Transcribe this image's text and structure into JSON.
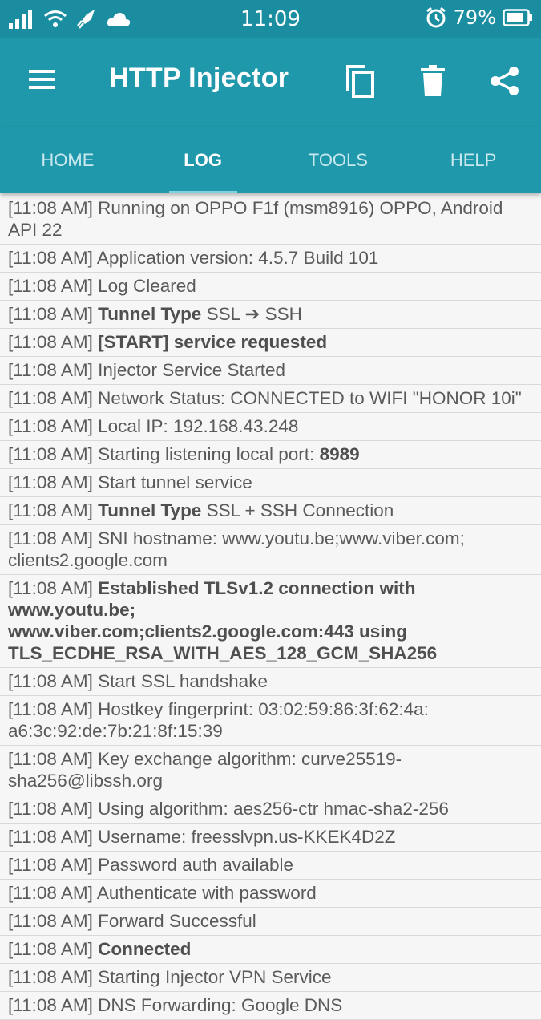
{
  "status_bar": {
    "time": "11:09",
    "battery": "79%",
    "icons": [
      "signal-icon",
      "wifi-icon",
      "rocket-icon",
      "cloud-icon",
      "alarm-icon",
      "battery-icon"
    ]
  },
  "toolbar": {
    "title": "HTTP Injector",
    "icons": [
      "menu-icon",
      "copy-icon",
      "delete-icon",
      "share-icon"
    ],
    "color": "#1f98ab"
  },
  "tabs": [
    {
      "label": "HOME",
      "active": false
    },
    {
      "label": "LOG",
      "active": true
    },
    {
      "label": "TOOLS",
      "active": false
    },
    {
      "label": "HELP",
      "active": false
    }
  ],
  "log": [
    {
      "time": "[11:08 AM]",
      "parts": [
        {
          "t": "Running on OPPO F1f (msm8916) OPPO, Android API 22"
        }
      ]
    },
    {
      "time": "[11:08 AM]",
      "parts": [
        {
          "t": "Application version: 4.5.7 Build 101"
        }
      ]
    },
    {
      "time": "[11:08 AM]",
      "parts": [
        {
          "t": "Log Cleared"
        }
      ]
    },
    {
      "time": "[11:08 AM]",
      "parts": [
        {
          "t": "Tunnel Type",
          "b": true
        },
        {
          "t": " SSL ➔ SSH"
        }
      ]
    },
    {
      "time": "[11:08 AM]",
      "parts": [
        {
          "t": "[START] service requested",
          "b": true
        }
      ]
    },
    {
      "time": "[11:08 AM]",
      "parts": [
        {
          "t": "Injector Service Started"
        }
      ]
    },
    {
      "time": "[11:08 AM]",
      "parts": [
        {
          "t": "Network Status: CONNECTED to WIFI \"HONOR 10i\""
        }
      ]
    },
    {
      "time": "[11:08 AM]",
      "parts": [
        {
          "t": "Local IP: 192.168.43.248"
        }
      ]
    },
    {
      "time": "[11:08 AM]",
      "parts": [
        {
          "t": "Starting listening local port: "
        },
        {
          "t": "8989",
          "b": true
        }
      ]
    },
    {
      "time": "[11:08 AM]",
      "parts": [
        {
          "t": "Start tunnel service"
        }
      ]
    },
    {
      "time": "[11:08 AM]",
      "parts": [
        {
          "t": "Tunnel Type",
          "b": true
        },
        {
          "t": " SSL + SSH Connection"
        }
      ]
    },
    {
      "time": "[11:08 AM]",
      "parts": [
        {
          "t": "SNI hostname: www.youtu.be;www.viber.com;\nclients2.google.com"
        }
      ]
    },
    {
      "time": "[11:08 AM]",
      "parts": [
        {
          "t": "Established TLSv1.2 connection with www.youtu.be;\nwww.viber.com;clients2.google.com:443 using\nTLS_ECDHE_RSA_WITH_AES_128_GCM_SHA256",
          "b": true
        }
      ]
    },
    {
      "time": "[11:08 AM]",
      "parts": [
        {
          "t": "Start SSL handshake"
        }
      ]
    },
    {
      "time": "[11:08 AM]",
      "parts": [
        {
          "t": "Hostkey fingerprint: 03:02:59:86:3f:62:4a:\na6:3c:92:de:7b:21:8f:15:39"
        }
      ]
    },
    {
      "time": "[11:08 AM]",
      "parts": [
        {
          "t": "Key exchange algorithm: curve25519-\nsha256@libssh.org"
        }
      ]
    },
    {
      "time": "[11:08 AM]",
      "parts": [
        {
          "t": "Using algorithm: aes256-ctr hmac-sha2-256"
        }
      ]
    },
    {
      "time": "[11:08 AM]",
      "parts": [
        {
          "t": "Username: freesslvpn.us-KKEK4D2Z"
        }
      ]
    },
    {
      "time": "[11:08 AM]",
      "parts": [
        {
          "t": "Password auth available"
        }
      ]
    },
    {
      "time": "[11:08 AM]",
      "parts": [
        {
          "t": "Authenticate with password"
        }
      ]
    },
    {
      "time": "[11:08 AM]",
      "parts": [
        {
          "t": "Forward Successful"
        }
      ]
    },
    {
      "time": "[11:08 AM]",
      "parts": [
        {
          "t": "Connected",
          "b": true
        }
      ]
    },
    {
      "time": "[11:08 AM]",
      "parts": [
        {
          "t": "Starting Injector VPN Service"
        }
      ]
    },
    {
      "time": "[11:08 AM]",
      "parts": [
        {
          "t": "DNS Forwarding: Google DNS"
        }
      ]
    }
  ]
}
